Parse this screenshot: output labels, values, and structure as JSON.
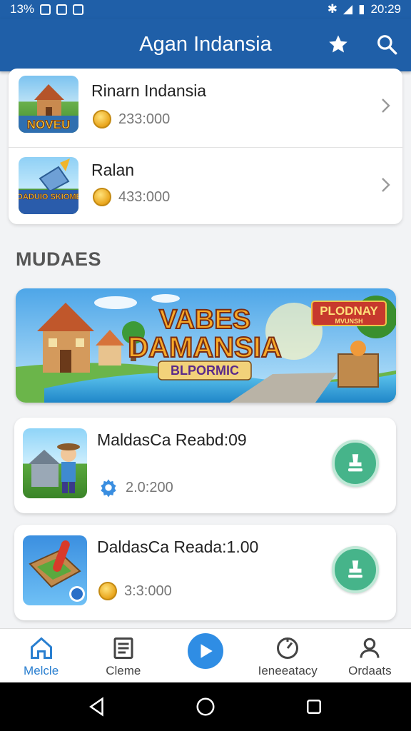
{
  "status_bar": {
    "left_text": "13%",
    "time": "20:29"
  },
  "app_bar": {
    "title": "Agan Indansia",
    "icons": [
      "star-icon",
      "search-icon"
    ]
  },
  "top_list": [
    {
      "title": "Rinarn Indansia",
      "price": "233:000",
      "thumb_text": "NOVEU"
    },
    {
      "title": "Ralan",
      "price": "433:000",
      "thumb_text": "GOADUIO SKIOMES"
    }
  ],
  "section": {
    "title": "MUDAES"
  },
  "banner": {
    "line1": "VABES",
    "line2": "DAMANSIA",
    "line3": "BLPORMIC",
    "badge_line1": "PLODNAY",
    "badge_line2": "MVUNSH"
  },
  "games": [
    {
      "title": "MaldasCa Reabd:09",
      "meta": "2.0:200",
      "meta_icon": "gear-icon"
    },
    {
      "title": "DaldasCa Reada:1.00",
      "meta": "3:3:000",
      "meta_icon": "coin-icon"
    }
  ],
  "bottom_nav": [
    {
      "label": "Melcle",
      "icon": "home-icon",
      "active": true
    },
    {
      "label": "Cleme",
      "icon": "list-icon",
      "active": false
    },
    {
      "label": "",
      "icon": "play-icon",
      "active": false
    },
    {
      "label": "Ieneeatacy",
      "icon": "gauge-icon",
      "active": false
    },
    {
      "label": "Ordaats",
      "icon": "person-icon",
      "active": false
    }
  ],
  "colors": {
    "primary": "#1f5fa8",
    "accent": "#2f8de4",
    "action_green": "#46b48a",
    "coin": "#e9a51c"
  }
}
